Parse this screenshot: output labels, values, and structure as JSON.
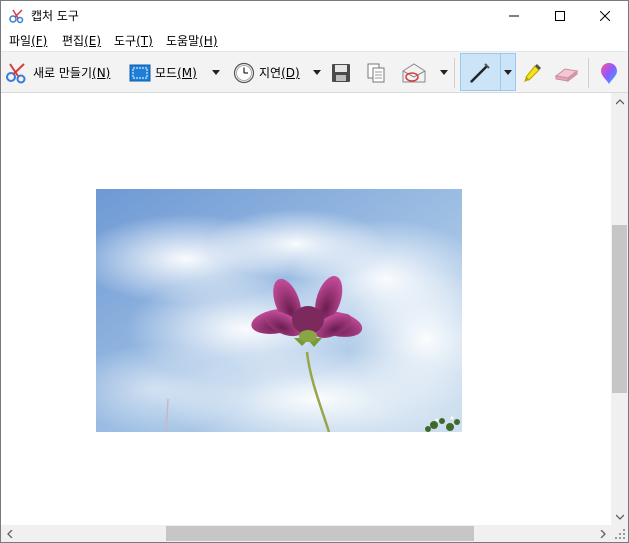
{
  "window": {
    "title": "캡처 도구"
  },
  "menu": {
    "items": [
      {
        "label": "파일",
        "accel": "(F)"
      },
      {
        "label": "편집",
        "accel": "(E)"
      },
      {
        "label": "도구",
        "accel": "(T)"
      },
      {
        "label": "도움말",
        "accel": "(H)"
      }
    ]
  },
  "toolbar": {
    "new_label": "새로 만들기",
    "new_accel": "(N)",
    "mode_label": "모드",
    "mode_accel": "(M)",
    "delay_label": "지연",
    "delay_accel": "(D)",
    "icons": [
      "scissors-icon",
      "mode-rectangle-icon",
      "clock-icon",
      "save-icon",
      "copy-icon",
      "send-email-icon",
      "pen-icon",
      "highlighter-icon",
      "eraser-icon",
      "paint3d-icon"
    ]
  },
  "colors": {
    "toolbar_bg": "#f3f3f3",
    "pen_selected_bg": "#cce4f7",
    "pen_selected_border": "#99c9ef",
    "scrollbar_thumb": "#c6c6c6"
  }
}
